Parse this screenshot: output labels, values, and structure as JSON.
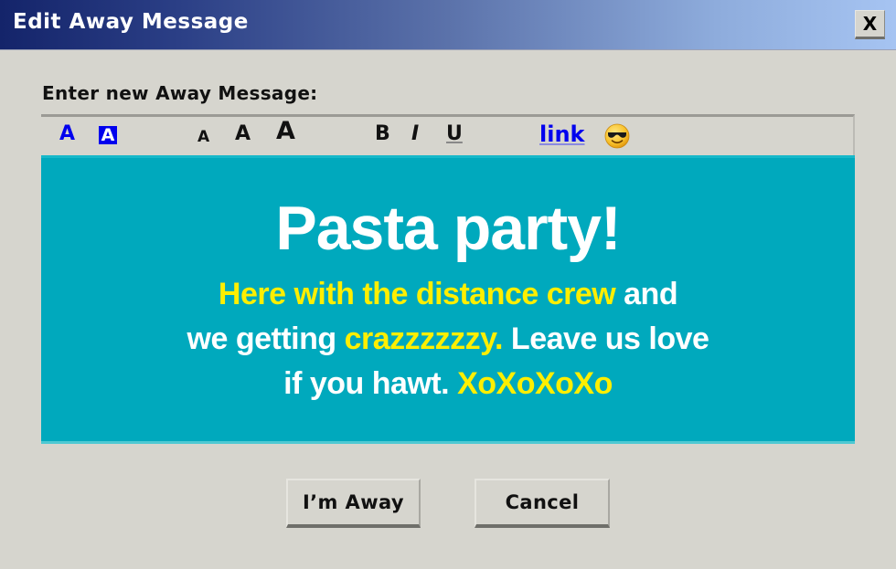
{
  "window": {
    "title": "Edit Away Message",
    "close_label": "X"
  },
  "prompt": "Enter new Away Message:",
  "toolbar": {
    "text_color_label": "A",
    "background_color_label": "A",
    "font_small_label": "A",
    "font_medium_label": "A",
    "font_large_label": "A",
    "bold_label": "B",
    "italic_label": "I",
    "underline_label": "U",
    "link_label": "link",
    "emoticon": "sunglasses-smiley-icon",
    "colors": {
      "text_color": "#0000ee",
      "link_color": "#0000ee"
    }
  },
  "message": {
    "background": "#00a9bd",
    "title": "Pasta party!",
    "line1_highlight": "Here with the distance crew",
    "line1_rest": " and",
    "line2_start": "we getting ",
    "line2_highlight": "crazzzzzzy.",
    "line2_rest": " Leave us love",
    "line3_start": "if you hawt. ",
    "line3_highlight": "XoXoXoXo",
    "colors": {
      "text": "#ffffff",
      "highlight": "#ffef00"
    }
  },
  "buttons": {
    "away_label": "I’m Away",
    "cancel_label": "Cancel"
  }
}
